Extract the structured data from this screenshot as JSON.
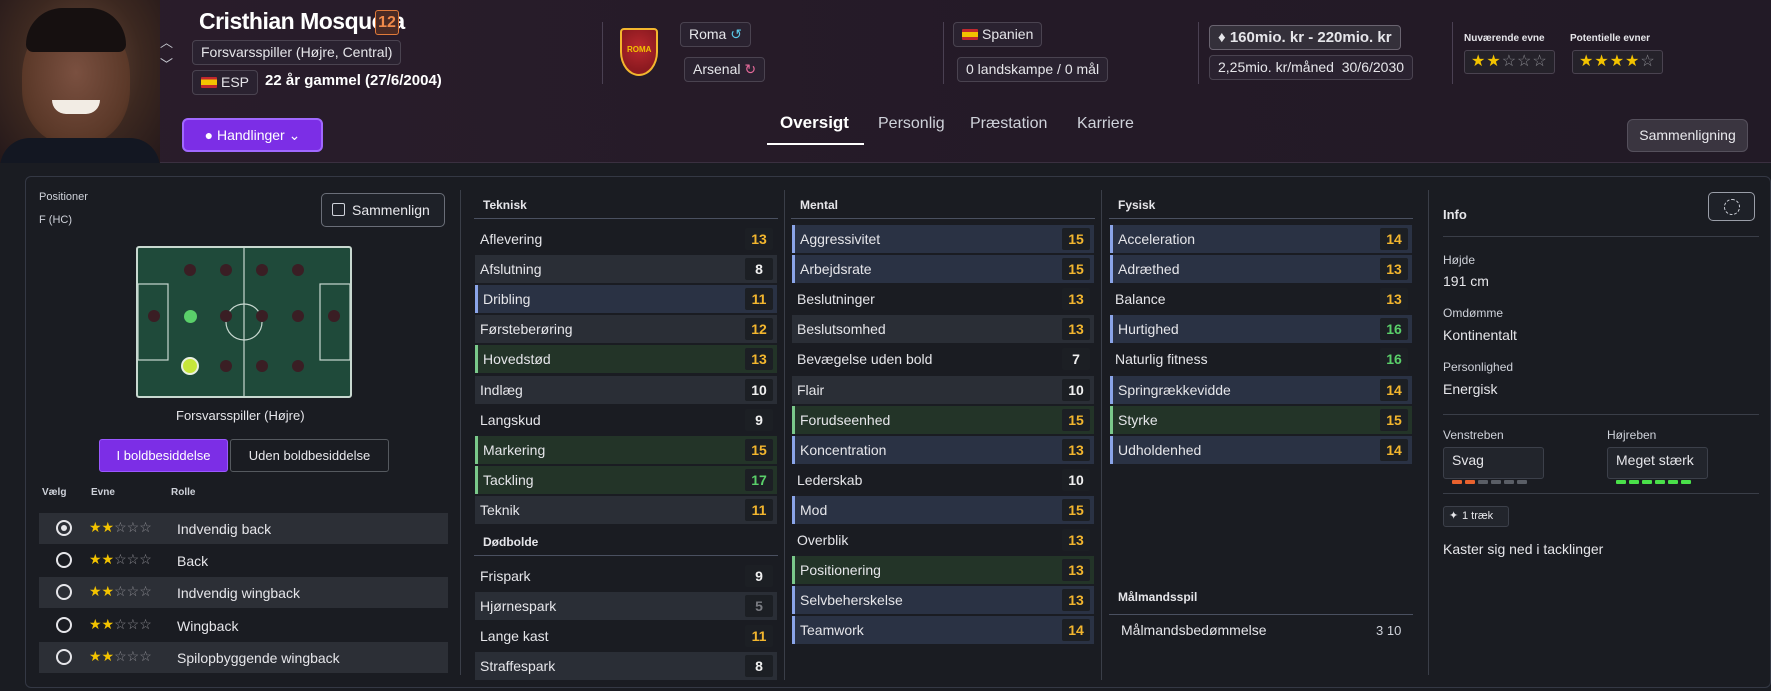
{
  "player": {
    "name": "Cristhian Mosquera",
    "number": "12",
    "position": "Forsvarsspiller (Højre, Central)",
    "nationality_code": "ESP",
    "age": "22 år gammel (27/6/2004)"
  },
  "clubs": {
    "current": "Roma",
    "loan_from": "Arsenal"
  },
  "country": {
    "name": "Spanien",
    "caps": "0 landskampe / 0 mål"
  },
  "value": {
    "range": "160mio. kr - 220mio. kr",
    "wage": "2,25mio. kr/måned",
    "contract_end": "30/6/2030"
  },
  "ability": {
    "current_label": "Nuværende evne",
    "current_stars": 2,
    "potential_label": "Potentielle evner",
    "potential_stars": 4
  },
  "actions_label": "Handlinger",
  "tabs": [
    "Oversigt",
    "Personlig",
    "Præstation",
    "Karriere"
  ],
  "compare_button": "Sammenligning",
  "positions": {
    "title": "Positioner",
    "value": "F (HC)",
    "compare_label": "Sammenlign",
    "selected_position": "Forsvarsspiller (Højre)",
    "toggle_in": "I boldbesiddelse",
    "toggle_out": "Uden boldbesiddelse",
    "col_select": "Vælg",
    "col_ability": "Evne",
    "col_role": "Rolle",
    "roles": [
      {
        "name": "Indvendig back",
        "stars": 2,
        "selected": true
      },
      {
        "name": "Back",
        "stars": 2,
        "selected": false
      },
      {
        "name": "Indvendig wingback",
        "stars": 2,
        "selected": false
      },
      {
        "name": "Wingback",
        "stars": 2,
        "selected": false
      },
      {
        "name": "Spilopbyggende wingback",
        "stars": 2,
        "selected": false
      }
    ]
  },
  "attributes": {
    "teknisk": {
      "title": "Teknisk",
      "items": [
        [
          "Aflevering",
          "13"
        ],
        [
          "Afslutning",
          "8"
        ],
        [
          "Dribling",
          "11"
        ],
        [
          "Førsteberøring",
          "12"
        ],
        [
          "Hovedstød",
          "13"
        ],
        [
          "Indlæg",
          "10"
        ],
        [
          "Langskud",
          "9"
        ],
        [
          "Markering",
          "15"
        ],
        [
          "Tackling",
          "17"
        ],
        [
          "Teknik",
          "11"
        ]
      ]
    },
    "dodbolde": {
      "title": "Dødbolde",
      "items": [
        [
          "Frispark",
          "9"
        ],
        [
          "Hjørnespark",
          "5"
        ],
        [
          "Lange kast",
          "11"
        ],
        [
          "Straffespark",
          "8"
        ]
      ]
    },
    "mental": {
      "title": "Mental",
      "items": [
        [
          "Aggressivitet",
          "15"
        ],
        [
          "Arbejdsrate",
          "15"
        ],
        [
          "Beslutninger",
          "13"
        ],
        [
          "Beslutsomhed",
          "13"
        ],
        [
          "Bevægelse uden bold",
          "7"
        ],
        [
          "Flair",
          "10"
        ],
        [
          "Forudseenhed",
          "15"
        ],
        [
          "Koncentration",
          "13"
        ],
        [
          "Lederskab",
          "10"
        ],
        [
          "Mod",
          "15"
        ],
        [
          "Overblik",
          "13"
        ],
        [
          "Positionering",
          "13"
        ],
        [
          "Selvbeherskelse",
          "13"
        ],
        [
          "Teamwork",
          "14"
        ]
      ]
    },
    "fysisk": {
      "title": "Fysisk",
      "items": [
        [
          "Acceleration",
          "14"
        ],
        [
          "Adræthed",
          "13"
        ],
        [
          "Balance",
          "13"
        ],
        [
          "Hurtighed",
          "16"
        ],
        [
          "Naturlig fitness",
          "16"
        ],
        [
          "Springrækkevidde",
          "14"
        ],
        [
          "Styrke",
          "15"
        ],
        [
          "Udholdenhed",
          "14"
        ]
      ]
    },
    "malmand": {
      "title": "Målmandsspil",
      "item": "Målmandsbedømmelse",
      "value": "3 10"
    }
  },
  "info": {
    "title": "Info",
    "height_label": "Højde",
    "height": "191 cm",
    "reputation_label": "Omdømme",
    "reputation": "Kontinentalt",
    "personality_label": "Personlighed",
    "personality": "Energisk",
    "left_foot_label": "Venstreben",
    "left_foot": "Svag",
    "right_foot_label": "Højreben",
    "right_foot": "Meget stærk",
    "traits_count": "1 træk",
    "trait": "Kaster sig ned i tacklinger"
  },
  "colors": {
    "accent": "#7c2ee6",
    "attr_yellow": "#f3b62e",
    "attr_green": "#5ad06a"
  }
}
